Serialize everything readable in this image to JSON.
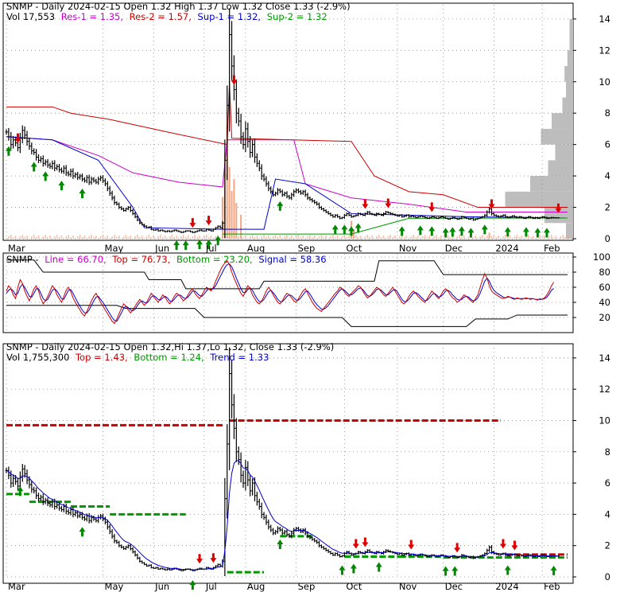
{
  "colors": {
    "price": "#000000",
    "volume": "#f4a582",
    "res1": "#cc00cc",
    "res2": "#cc0000",
    "sup1": "#0000cc",
    "sup2": "#009900",
    "sell_arrow": "#dd0000",
    "buy_arrow": "#008800",
    "stoch_line": "#0000cc",
    "stoch_signal": "#cc0000",
    "band": "#000000",
    "grid": "#888888",
    "volume_profile": "#bdbdbd"
  },
  "panel1": {
    "header": {
      "title": "SNMP - Daily 2024-02-15 Open 1.32  High 1.37  Low 1.32  Close 1.33 (-2.9%)",
      "vol": "Vol 17,553",
      "res1": "Res-1 = 1.35,",
      "res2": "Res-2 = 1.57,",
      "sup1": "Sup-1 = 1.32,",
      "sup2": "Sup-2 = 1.32"
    },
    "y_ticks": [
      "0",
      "2",
      "4",
      "6",
      "8",
      "10",
      "12",
      "14"
    ],
    "x_ticks": [
      "Mar",
      "May",
      "Jun",
      "Jul",
      "Aug",
      "Sep",
      "Oct",
      "Nov",
      "Dec",
      "2024",
      "Feb"
    ]
  },
  "panel2": {
    "header": {
      "name": "SNMP -",
      "line": "Line = 66.70,",
      "top": "Top = 76.73,",
      "bottom": "Bottom = 23.20,",
      "signal": "Signal = 58.36"
    },
    "y_ticks": [
      "20",
      "40",
      "60",
      "80",
      "100"
    ]
  },
  "panel3": {
    "header": {
      "title": "SNMP - Daily 2024-02-15 Open 1.32,Hi 1.37,Lo 1.32, Close 1.33 (-2.9%)",
      "vol": "Vol 1,755,300",
      "top": "Top = 1.43,",
      "bottom": "Bottom = 1.24,",
      "trend": "Trend = 1.33"
    },
    "y_ticks": [
      "0",
      "2",
      "4",
      "6",
      "8",
      "10",
      "12",
      "14"
    ],
    "x_ticks": [
      "Mar",
      "May",
      "Jun",
      "Jul",
      "Aug",
      "Sep",
      "Oct",
      "Nov",
      "Dec",
      "2024",
      "Feb"
    ]
  },
  "chart_data": [
    {
      "type": "line",
      "title": "SNMP - Daily 2024-02-15 Open 1.32  High 1.37  Low 1.32  Close 1.33 (-2.9%)",
      "ylim": [
        0,
        14.5
      ],
      "months": [
        "Mar",
        "May",
        "Jun",
        "Jul",
        "Aug",
        "Sep",
        "Oct",
        "Nov",
        "Dec",
        "2024",
        "Feb"
      ],
      "month_index": [
        0,
        42,
        64,
        86,
        104,
        126,
        147,
        170,
        190,
        212,
        233
      ],
      "n_days": 245,
      "close": [
        6.8,
        6.5,
        6.0,
        6.3,
        6.1,
        5.8,
        6.4,
        6.9,
        6.6,
        6.2,
        5.9,
        5.6,
        5.5,
        5.2,
        5.0,
        5.1,
        4.8,
        4.9,
        4.7,
        4.6,
        4.8,
        4.5,
        4.6,
        4.4,
        4.3,
        4.5,
        4.2,
        4.1,
        4.3,
        4.0,
        4.1,
        3.9,
        4.0,
        3.8,
        3.7,
        3.9,
        3.6,
        3.8,
        3.7,
        3.6,
        3.8,
        3.9,
        3.7,
        3.5,
        3.2,
        2.9,
        2.6,
        2.3,
        2.2,
        2.0,
        1.9,
        1.8,
        1.9,
        2.0,
        1.8,
        1.6,
        1.4,
        1.2,
        1.0,
        0.9,
        0.8,
        0.7,
        0.75,
        0.6,
        0.55,
        0.6,
        0.5,
        0.55,
        0.5,
        0.45,
        0.5,
        0.45,
        0.5,
        0.55,
        0.5,
        0.45,
        0.4,
        0.45,
        0.5,
        0.5,
        0.45,
        0.4,
        0.45,
        0.5,
        0.55,
        0.5,
        0.5,
        0.6,
        0.55,
        0.5,
        0.6,
        0.7,
        0.8,
        0.7,
        1.0,
        5.0,
        8.5,
        13.0,
        11.0,
        9.5,
        8.0,
        7.5,
        6.5,
        6.0,
        7.0,
        6.2,
        5.5,
        6.0,
        5.2,
        4.8,
        4.5,
        4.0,
        3.8,
        3.5,
        3.2,
        3.0,
        2.8,
        2.9,
        3.1,
        3.0,
        2.8,
        2.9,
        2.7,
        2.6,
        2.8,
        3.0,
        3.1,
        3.0,
        2.9,
        3.0,
        2.8,
        2.6,
        2.5,
        2.4,
        2.3,
        2.2,
        2.0,
        1.9,
        1.8,
        1.7,
        1.6,
        1.5,
        1.4,
        1.5,
        1.4,
        1.3,
        1.35,
        1.5,
        1.6,
        1.5,
        1.4,
        1.45,
        1.5,
        1.6,
        1.55,
        1.5,
        1.6,
        1.7,
        1.6,
        1.55,
        1.5,
        1.6,
        1.55,
        1.5,
        1.6,
        1.7,
        1.65,
        1.6,
        1.55,
        1.5,
        1.45,
        1.5,
        1.4,
        1.45,
        1.5,
        1.4,
        1.45,
        1.4,
        1.35,
        1.4,
        1.45,
        1.4,
        1.35,
        1.3,
        1.35,
        1.4,
        1.35,
        1.3,
        1.35,
        1.4,
        1.35,
        1.3,
        1.25,
        1.3,
        1.35,
        1.3,
        1.25,
        1.3,
        1.4,
        1.35,
        1.3,
        1.25,
        1.3,
        1.2,
        1.25,
        1.3,
        1.35,
        1.4,
        1.5,
        1.7,
        1.9,
        1.6,
        1.5,
        1.45,
        1.4,
        1.45,
        1.5,
        1.4,
        1.35,
        1.4,
        1.45,
        1.4,
        1.35,
        1.4,
        1.35,
        1.3,
        1.35,
        1.4,
        1.35,
        1.3,
        1.35,
        1.3,
        1.35,
        1.4,
        1.35,
        1.3,
        1.32,
        1.35,
        1.33,
        1.33,
        1.33
      ],
      "res2": [
        [
          0,
          8.4
        ],
        [
          20,
          8.4
        ],
        [
          28,
          8.0
        ],
        [
          45,
          7.6
        ],
        [
          70,
          6.8
        ],
        [
          96,
          6.0
        ],
        [
          97,
          10.0
        ],
        [
          98,
          6.4
        ],
        [
          150,
          6.2
        ],
        [
          160,
          4.0
        ],
        [
          175,
          3.0
        ],
        [
          190,
          2.8
        ],
        [
          205,
          2.0
        ],
        [
          244,
          2.0
        ]
      ],
      "res1": [
        [
          0,
          6.5
        ],
        [
          20,
          6.3
        ],
        [
          40,
          5.3
        ],
        [
          55,
          4.2
        ],
        [
          75,
          3.6
        ],
        [
          94,
          3.3
        ],
        [
          96,
          6.3
        ],
        [
          125,
          6.3
        ],
        [
          130,
          3.5
        ],
        [
          150,
          2.6
        ],
        [
          175,
          2.2
        ],
        [
          200,
          1.7
        ],
        [
          244,
          1.7
        ]
      ],
      "sup1": [
        [
          0,
          6.5
        ],
        [
          20,
          6.3
        ],
        [
          40,
          5.0
        ],
        [
          55,
          2.0
        ],
        [
          60,
          0.7
        ],
        [
          94,
          0.6
        ],
        [
          112,
          0.6
        ],
        [
          117,
          3.8
        ],
        [
          130,
          3.5
        ],
        [
          150,
          1.6
        ],
        [
          175,
          1.5
        ],
        [
          200,
          1.4
        ],
        [
          244,
          1.32
        ]
      ],
      "sup2": [
        [
          94,
          0.3
        ],
        [
          150,
          0.3
        ],
        [
          175,
          1.3
        ],
        [
          244,
          1.32
        ]
      ],
      "volume_spikes": [
        [
          94,
          0.35
        ],
        [
          95,
          0.7
        ],
        [
          96,
          0.95
        ],
        [
          97,
          0.6
        ],
        [
          98,
          0.4
        ],
        [
          99,
          0.5
        ],
        [
          100,
          0.3
        ],
        [
          102,
          0.2
        ],
        [
          150,
          0.15
        ],
        [
          151,
          0.08
        ],
        [
          210,
          0.05
        ]
      ],
      "sell_arrows": [
        5,
        81,
        88,
        99,
        156,
        166,
        185,
        211,
        240
      ],
      "buy_arrows": [
        1,
        12,
        17,
        24,
        33,
        74,
        78,
        84,
        88,
        92,
        119,
        143,
        147,
        150,
        153,
        172,
        180,
        185,
        191,
        194,
        198,
        202,
        208,
        218,
        226,
        231,
        235
      ]
    },
    {
      "type": "line",
      "ylim": [
        0,
        100
      ],
      "series_keys": [
        "line",
        "signal",
        "top",
        "bottom"
      ],
      "line": [
        55,
        62,
        58,
        50,
        45,
        60,
        70,
        65,
        55,
        48,
        42,
        50,
        58,
        62,
        55,
        45,
        38,
        42,
        48,
        55,
        62,
        58,
        50,
        45,
        40,
        48,
        56,
        60,
        54,
        46,
        40,
        35,
        30,
        25,
        22,
        28,
        35,
        42,
        48,
        52,
        46,
        40,
        35,
        30,
        25,
        20,
        15,
        12,
        18,
        25,
        32,
        38,
        35,
        30,
        26,
        30,
        35,
        40,
        44,
        40,
        36,
        40,
        46,
        52,
        48,
        44,
        40,
        45,
        50,
        47,
        42,
        38,
        42,
        48,
        52,
        50,
        46,
        42,
        45,
        50,
        55,
        58,
        52,
        48,
        45,
        50,
        55,
        60,
        58,
        55,
        60,
        68,
        75,
        82,
        88,
        92,
        95,
        90,
        80,
        72,
        65,
        58,
        52,
        48,
        55,
        62,
        58,
        50,
        45,
        40,
        38,
        42,
        48,
        55,
        60,
        56,
        50,
        45,
        40,
        38,
        42,
        48,
        52,
        50,
        46,
        42,
        40,
        45,
        50,
        55,
        58,
        52,
        46,
        40,
        36,
        32,
        30,
        28,
        32,
        36,
        40,
        44,
        48,
        52,
        55,
        60,
        58,
        54,
        50,
        48,
        52,
        55,
        58,
        62,
        60,
        55,
        50,
        46,
        48,
        52,
        56,
        60,
        58,
        54,
        50,
        48,
        52,
        56,
        60,
        55,
        50,
        45,
        40,
        38,
        42,
        48,
        52,
        55,
        52,
        48,
        45,
        42,
        40,
        45,
        50,
        55,
        52,
        48,
        45,
        50,
        55,
        58,
        55,
        50,
        46,
        44,
        40,
        42,
        46,
        50,
        48,
        45,
        42,
        40,
        45,
        50,
        60,
        70,
        78,
        72,
        62,
        55,
        52,
        50,
        48,
        46,
        45,
        46,
        48,
        47,
        45,
        44,
        46,
        45,
        44,
        45,
        46,
        45,
        44,
        45,
        44,
        43,
        45,
        44,
        46,
        50,
        55,
        62,
        66.7
      ],
      "signal": [
        52,
        56,
        58,
        55,
        50,
        52,
        60,
        64,
        60,
        54,
        48,
        47,
        52,
        58,
        58,
        52,
        45,
        42,
        44,
        50,
        56,
        58,
        55,
        50,
        45,
        44,
        50,
        56,
        57,
        52,
        46,
        40,
        35,
        30,
        26,
        26,
        30,
        36,
        42,
        47,
        48,
        44,
        40,
        35,
        30,
        25,
        20,
        16,
        15,
        20,
        26,
        32,
        35,
        33,
        30,
        29,
        31,
        36,
        40,
        42,
        40,
        39,
        42,
        47,
        49,
        47,
        44,
        43,
        46,
        48,
        46,
        42,
        41,
        44,
        48,
        50,
        49,
        46,
        45,
        47,
        51,
        55,
        55,
        52,
        49,
        48,
        51,
        55,
        58,
        57,
        58,
        62,
        68,
        74,
        80,
        86,
        90,
        91,
        87,
        80,
        72,
        65,
        58,
        53,
        53,
        57,
        59,
        56,
        50,
        45,
        41,
        41,
        44,
        49,
        54,
        56,
        53,
        49,
        44,
        41,
        41,
        44,
        48,
        50,
        49,
        46,
        43,
        43,
        46,
        50,
        54,
        55,
        51,
        46,
        41,
        37,
        34,
        31,
        31,
        33,
        36,
        40,
        44,
        48,
        52,
        56,
        58,
        56,
        53,
        50,
        50,
        52,
        55,
        58,
        59,
        57,
        53,
        49,
        48,
        50,
        53,
        57,
        58,
        56,
        53,
        50,
        50,
        53,
        56,
        57,
        54,
        49,
        44,
        41,
        41,
        44,
        48,
        52,
        53,
        51,
        48,
        45,
        42,
        43,
        46,
        50,
        52,
        50,
        47,
        48,
        51,
        55,
        56,
        54,
        50,
        47,
        44,
        43,
        44,
        47,
        48,
        47,
        44,
        42,
        43,
        46,
        52,
        60,
        68,
        72,
        68,
        61,
        56,
        53,
        51,
        49,
        47,
        46,
        47,
        47,
        46,
        45,
        45,
        45,
        45,
        45,
        45,
        45,
        45,
        45,
        44,
        44,
        44,
        44,
        45,
        47,
        51,
        56,
        58.36
      ],
      "top": [
        [
          0,
          96
        ],
        [
          12,
          96
        ],
        [
          16,
          80
        ],
        [
          60,
          80
        ],
        [
          62,
          70
        ],
        [
          76,
          70
        ],
        [
          78,
          58
        ],
        [
          110,
          58
        ],
        [
          112,
          68
        ],
        [
          160,
          68
        ],
        [
          162,
          95
        ],
        [
          186,
          95
        ],
        [
          190,
          76.73
        ],
        [
          244,
          76.73
        ]
      ],
      "bottom": [
        [
          0,
          36
        ],
        [
          48,
          36
        ],
        [
          52,
          32
        ],
        [
          82,
          32
        ],
        [
          86,
          20
        ],
        [
          146,
          20
        ],
        [
          150,
          8
        ],
        [
          200,
          8
        ],
        [
          204,
          18
        ],
        [
          218,
          18
        ],
        [
          222,
          23.2
        ],
        [
          244,
          23.2
        ]
      ]
    },
    {
      "type": "line",
      "title": "SNMP - Daily 2024-02-15 Open 1.32,Hi 1.37,Lo 1.32, Close 1.33 (-2.9%)",
      "ylim": [
        0,
        14.5
      ],
      "top_segments": [
        [
          0,
          95,
          9.7
        ],
        [
          97,
          215,
          10.0
        ],
        [
          217,
          244,
          1.43
        ]
      ],
      "bottom_segments": [
        [
          0,
          10,
          5.3
        ],
        [
          10,
          28,
          4.8
        ],
        [
          28,
          45,
          4.5
        ],
        [
          45,
          78,
          4.0
        ],
        [
          96,
          112,
          0.3
        ],
        [
          119,
          133,
          2.6
        ],
        [
          147,
          171,
          1.3
        ],
        [
          171,
          190,
          1.3
        ],
        [
          190,
          217,
          1.24
        ],
        [
          217,
          244,
          1.24
        ]
      ],
      "trend": "ema",
      "sell_arrows": [
        84,
        90,
        152,
        156,
        176,
        196,
        216,
        221
      ],
      "buy_arrows": [
        6,
        33,
        81,
        119,
        146,
        151,
        162,
        191,
        195,
        218,
        238
      ]
    }
  ]
}
